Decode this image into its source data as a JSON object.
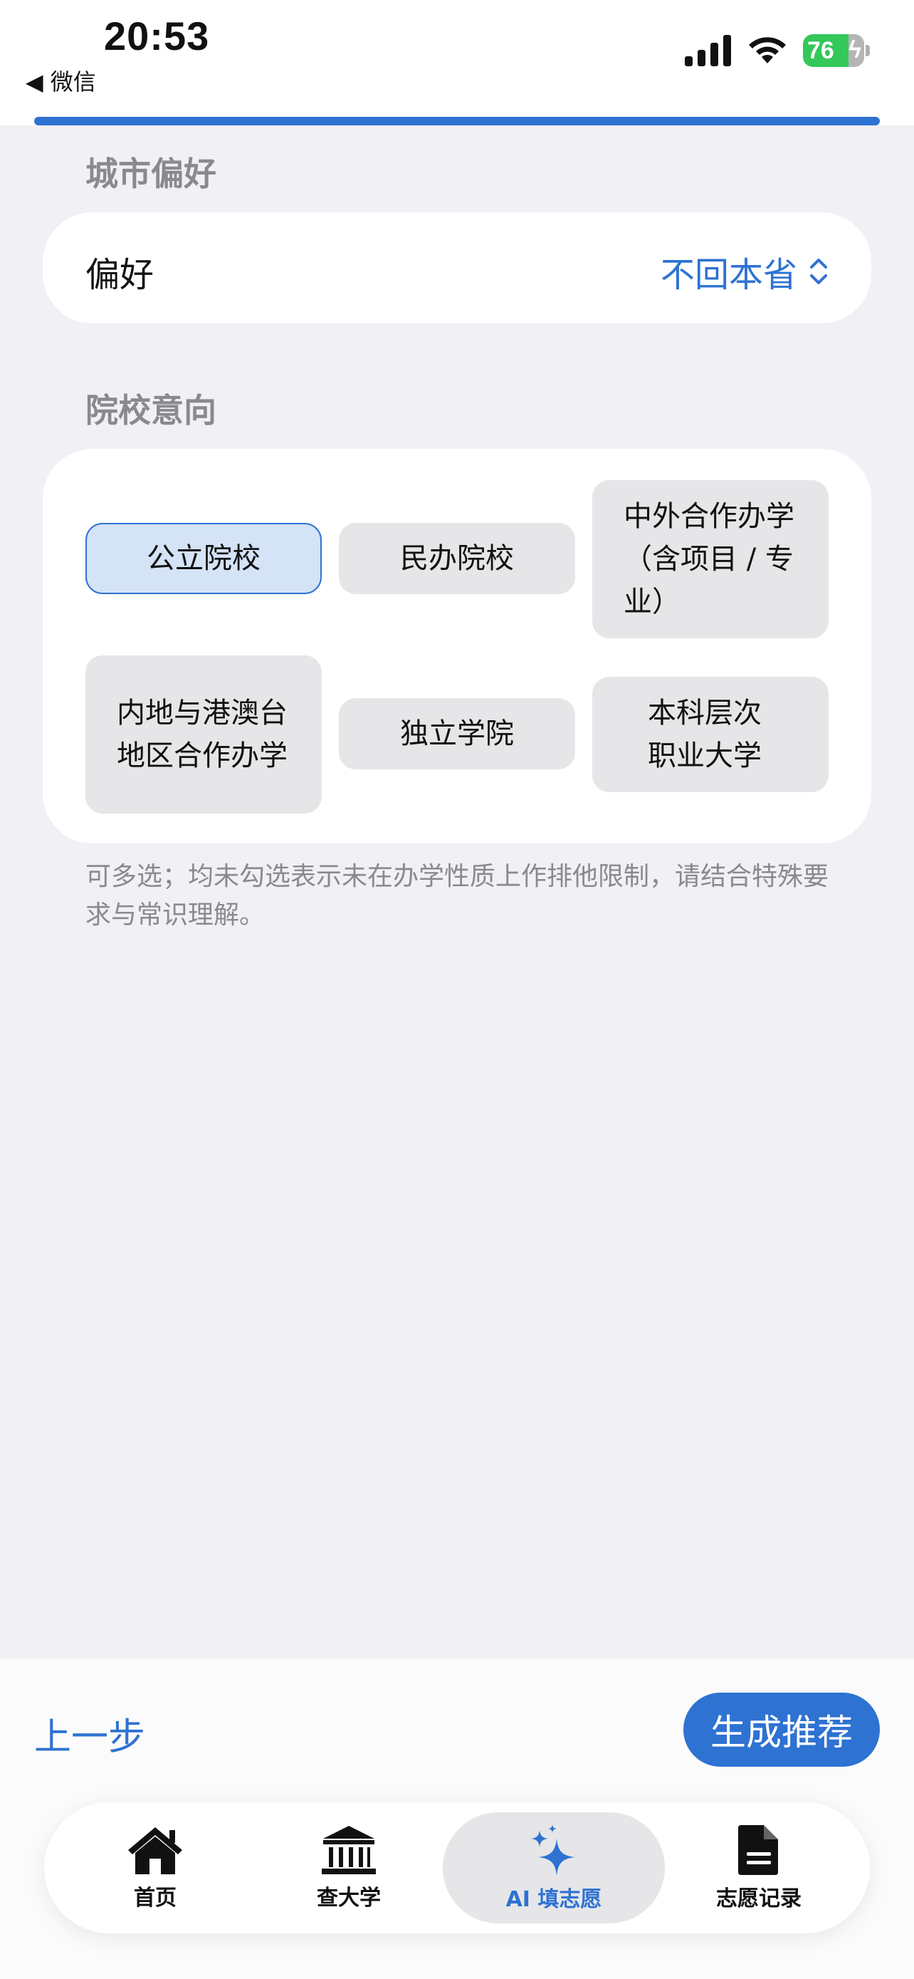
{
  "status_bar": {
    "time": "20:53",
    "back_app": "◀ 微信",
    "battery": "76"
  },
  "city_section": {
    "title": "城市偏好",
    "label": "偏好",
    "value": "不回本省"
  },
  "school_section": {
    "title": "院校意向",
    "chips": [
      {
        "label": "公立院校",
        "selected": true
      },
      {
        "label": "民办院校",
        "selected": false
      },
      {
        "label": "中外合作办学（含项目 / 专业）",
        "selected": false
      },
      {
        "label": "内地与港澳台地区合作办学",
        "selected": false
      },
      {
        "label": "独立学院",
        "selected": false
      },
      {
        "label": "本科层次职业大学",
        "selected": false
      }
    ],
    "hint": "可多选；均未勾选表示未在办学性质上作排他限制，请结合特殊要求与常识理解。"
  },
  "actions": {
    "prev": "上一步",
    "generate": "生成推荐"
  },
  "tabs": [
    {
      "label": "首页",
      "icon": "home-icon"
    },
    {
      "label": "查大学",
      "icon": "university-icon"
    },
    {
      "label": "AI 填志愿",
      "icon": "sparkle-icon",
      "active": true
    },
    {
      "label": "志愿记录",
      "icon": "document-icon"
    }
  ],
  "colors": {
    "accent": "#2e72d2",
    "background": "#f0f0f5",
    "chip": "#e6e6e9",
    "chip_selected": "#d4e3f5",
    "battery": "#34c759"
  }
}
